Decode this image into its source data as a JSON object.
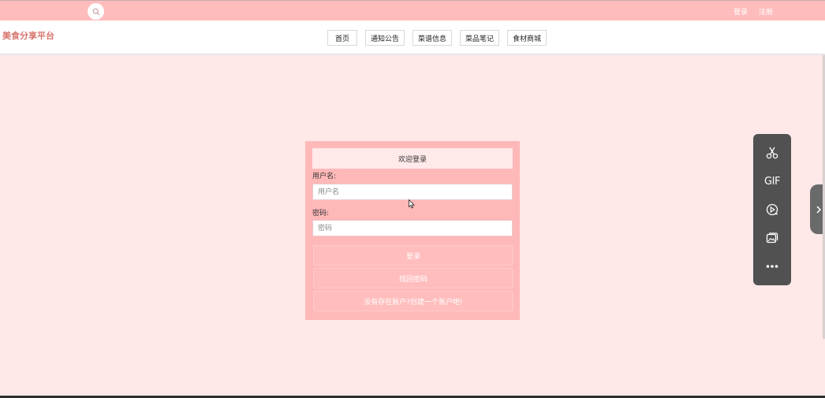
{
  "topbar": {
    "search_icon": "search-icon",
    "login_link": "登录",
    "register_link": "注册"
  },
  "header": {
    "brand": "美食分享平台",
    "nav": [
      {
        "label": "首页"
      },
      {
        "label": "通知公告"
      },
      {
        "label": "菜谱信息"
      },
      {
        "label": "菜品笔记"
      },
      {
        "label": "食材商城"
      }
    ]
  },
  "login": {
    "title": "欢迎登录",
    "username_label": "用户名:",
    "username_placeholder": "用户名",
    "password_label": "密码:",
    "password_placeholder": "密码",
    "login_button": "登录",
    "forgot_button": "找回密码",
    "register_button": "没有存在账户?创建一个账户吧!"
  },
  "toolbar": {
    "tools": [
      "scissors-icon",
      "gif-icon",
      "screen-record-icon",
      "image-icon",
      "more-icon"
    ],
    "gif_label": "GIF"
  },
  "colors": {
    "topbar": "#ffbcbc",
    "page_bg": "#ffe8e8",
    "brand": "#d9766f",
    "card_bg": "#ffb8b8",
    "button_bg": "#ffbdbd",
    "tool_panel": "#515151"
  }
}
